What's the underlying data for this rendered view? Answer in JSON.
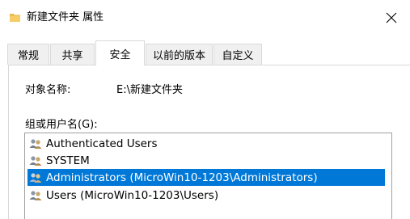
{
  "window": {
    "title": "新建文件夹 属性",
    "close_symbol": "✕"
  },
  "tabs": [
    {
      "label": "常规",
      "active": false
    },
    {
      "label": "共享",
      "active": false
    },
    {
      "label": "安全",
      "active": true
    },
    {
      "label": "以前的版本",
      "active": false
    },
    {
      "label": "自定义",
      "active": false
    }
  ],
  "security": {
    "object_name_label": "对象名称:",
    "object_name_value": "E:\\新建文件夹",
    "group_label": "组或用户名(G):",
    "users": [
      {
        "name": "Authenticated Users",
        "selected": false
      },
      {
        "name": "SYSTEM",
        "selected": false
      },
      {
        "name": "Administrators (MicroWin10-1203\\Administrators)",
        "selected": true
      },
      {
        "name": "Users (MicroWin10-1203\\Users)",
        "selected": false
      }
    ]
  },
  "colors": {
    "selection": "#0078d7",
    "folder": "#e8b84a",
    "tab_inactive": "#f0f0f0",
    "border": "#d9d9d9"
  },
  "icons": {
    "title": "folder-icon",
    "close": "close-icon",
    "user": "user-group-icon"
  }
}
